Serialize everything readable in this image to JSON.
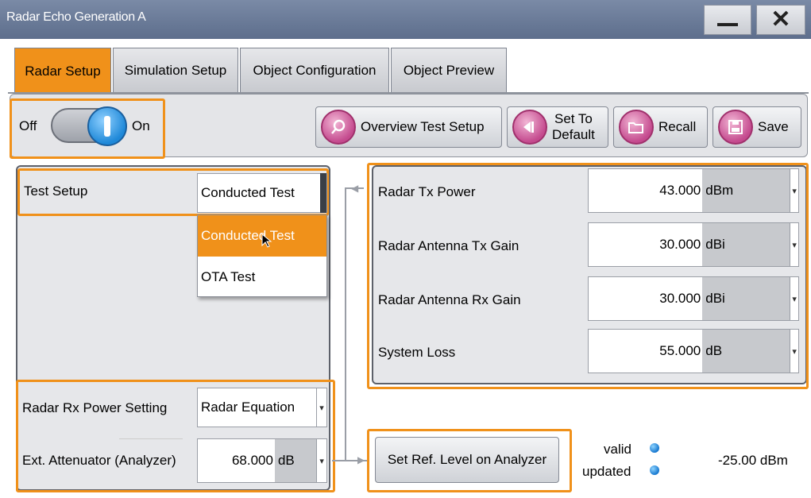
{
  "window": {
    "title": "Radar Echo Generation A"
  },
  "tabs": [
    {
      "label": "Radar Setup",
      "active": true
    },
    {
      "label": "Simulation Setup",
      "active": false
    },
    {
      "label": "Object Configuration",
      "active": false
    },
    {
      "label": "Object Preview",
      "active": false
    }
  ],
  "toggle": {
    "off_label": "Off",
    "on_label": "On",
    "state": "on"
  },
  "toolbar": {
    "overview": "Overview Test Setup",
    "set_default_line1": "Set To",
    "set_default_line2": "Default",
    "recall": "Recall",
    "save": "Save"
  },
  "test_setup": {
    "label": "Test Setup",
    "value": "Conducted Test",
    "options": [
      "Conducted Test",
      "OTA Test"
    ],
    "highlighted_option": "Conducted Test"
  },
  "radar_params": [
    {
      "label": "Radar Tx Power",
      "value": "43.000",
      "unit": "dBm"
    },
    {
      "label": "Radar Antenna Tx Gain",
      "value": "30.000",
      "unit": "dBi"
    },
    {
      "label": "Radar Antenna Rx Gain",
      "value": "30.000",
      "unit": "dBi"
    },
    {
      "label": "System Loss",
      "value": "55.000",
      "unit": "dB"
    }
  ],
  "rx_power": {
    "label": "Radar Rx Power Setting",
    "value": "Radar Equation"
  },
  "attenuator": {
    "label": "Ext. Attenuator (Analyzer)",
    "value": "68.000",
    "unit": "dB"
  },
  "ref_level": {
    "button": "Set Ref. Level on Analyzer",
    "valid_label": "valid",
    "updated_label": "updated",
    "value": "-25.00 dBm"
  },
  "colors": {
    "accent": "#f0911a",
    "titlebar": "#6b7c99",
    "indicator": "#1e88d8"
  }
}
